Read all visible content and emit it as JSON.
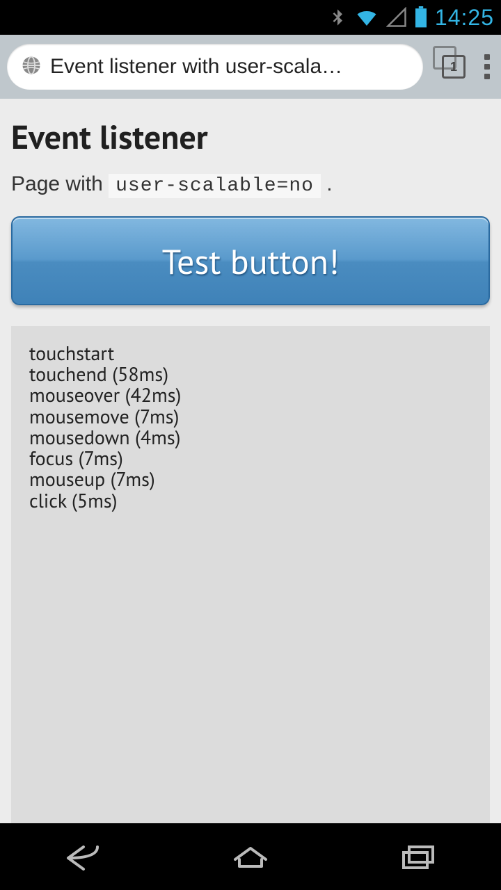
{
  "status": {
    "time": "14:25"
  },
  "browser": {
    "page_title": "Event listener with user-scala…",
    "tab_count": "1"
  },
  "page": {
    "heading": "Event listener",
    "subtitle_pre": "Page with ",
    "subtitle_code": "user-scalable=no",
    "subtitle_post": " .",
    "button_label": "Test button!",
    "events": [
      "touchstart",
      "touchend (58ms)",
      "mouseover (42ms)",
      "mousemove (7ms)",
      "mousedown (4ms)",
      "focus (7ms)",
      "mouseup (7ms)",
      "click (5ms)"
    ]
  }
}
